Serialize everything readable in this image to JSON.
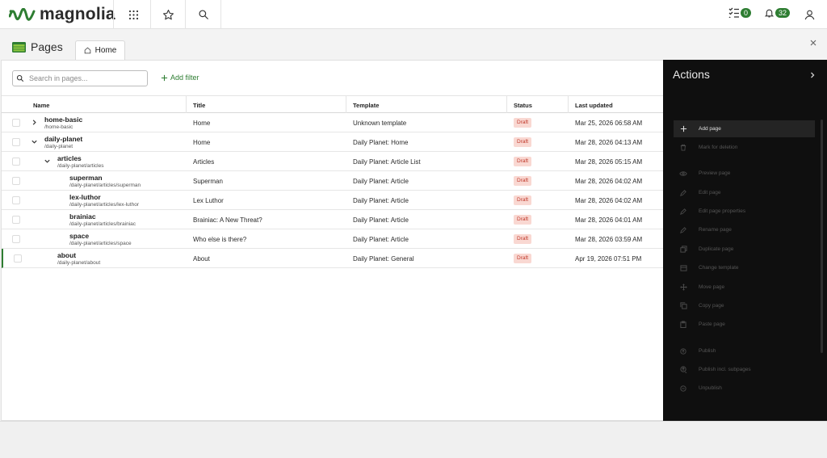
{
  "brand": {
    "name": "magnolia",
    "green": "#2e7d32"
  },
  "topbar": {
    "tasks_count": "0",
    "notifications_count": "32",
    "icons": [
      "apps-grid-icon",
      "star-icon",
      "search-icon",
      "tasks-icon",
      "bell-icon",
      "user-icon"
    ]
  },
  "app": {
    "title": "Pages",
    "tab_label": "Home"
  },
  "search": {
    "placeholder": "Search in pages..."
  },
  "filter": {
    "add_label": "Add filter"
  },
  "table": {
    "columns": [
      "Name",
      "Title",
      "Template",
      "Status",
      "Last updated"
    ],
    "rows": [
      {
        "name": "home-basic",
        "path": "/home-basic",
        "title": "Home",
        "template": "Unknown template",
        "status": "Draft",
        "updated": "Mar 25, 2026 06:58 AM"
      },
      {
        "name": "daily-planet",
        "path": "/daily-planet",
        "title": "Home",
        "template": "Daily Planet: Home",
        "status": "Draft",
        "updated": "Mar 28, 2026 04:13 AM"
      },
      {
        "name": "articles",
        "path": "/daily-planet/articles",
        "title": "Articles",
        "template": "Daily Planet: Article List",
        "status": "Draft",
        "updated": "Mar 28, 2026 05:15 AM"
      },
      {
        "name": "superman",
        "path": "/daily-planet/articles/superman",
        "title": "Superman",
        "template": "Daily Planet: Article",
        "status": "Draft",
        "updated": "Mar 28, 2026 04:02 AM"
      },
      {
        "name": "lex-luthor",
        "path": "/daily-planet/articles/lex-luthor",
        "title": "Lex Luthor",
        "template": "Daily Planet: Article",
        "status": "Draft",
        "updated": "Mar 28, 2026 04:02 AM"
      },
      {
        "name": "brainiac",
        "path": "/daily-planet/articles/brainiac",
        "title": "Brainiac: A New Threat?",
        "template": "Daily Planet: Article",
        "status": "Draft",
        "updated": "Mar 28, 2026 04:01 AM"
      },
      {
        "name": "space",
        "path": "/daily-planet/articles/space",
        "title": "Who else is there?",
        "template": "Daily Planet: Article",
        "status": "Draft",
        "updated": "Mar 28, 2026 03:59 AM"
      },
      {
        "name": "about",
        "path": "/daily-planet/about",
        "title": "About",
        "template": "Daily Planet: General",
        "status": "Draft",
        "updated": "Apr 19, 2026 07:51 PM"
      }
    ]
  },
  "actions": {
    "title": "Actions",
    "items": [
      {
        "label": "Add page",
        "icon": "plus-icon"
      },
      {
        "label": "Mark for deletion",
        "icon": "trash-icon"
      },
      {
        "label": "Preview page",
        "icon": "eye-icon"
      },
      {
        "label": "Edit page",
        "icon": "pencil-icon"
      },
      {
        "label": "Edit page properties",
        "icon": "pencil-icon"
      },
      {
        "label": "Rename page",
        "icon": "pencil-icon"
      },
      {
        "label": "Duplicate page",
        "icon": "duplicate-icon"
      },
      {
        "label": "Change template",
        "icon": "template-icon"
      },
      {
        "label": "Move page",
        "icon": "move-icon"
      },
      {
        "label": "Copy page",
        "icon": "copy-icon"
      },
      {
        "label": "Paste page",
        "icon": "paste-icon"
      },
      {
        "label": "Publish",
        "icon": "publish-icon"
      },
      {
        "label": "Publish incl. subpages",
        "icon": "publish-subpages-icon"
      },
      {
        "label": "Unpublish",
        "icon": "unpublish-icon"
      }
    ]
  }
}
